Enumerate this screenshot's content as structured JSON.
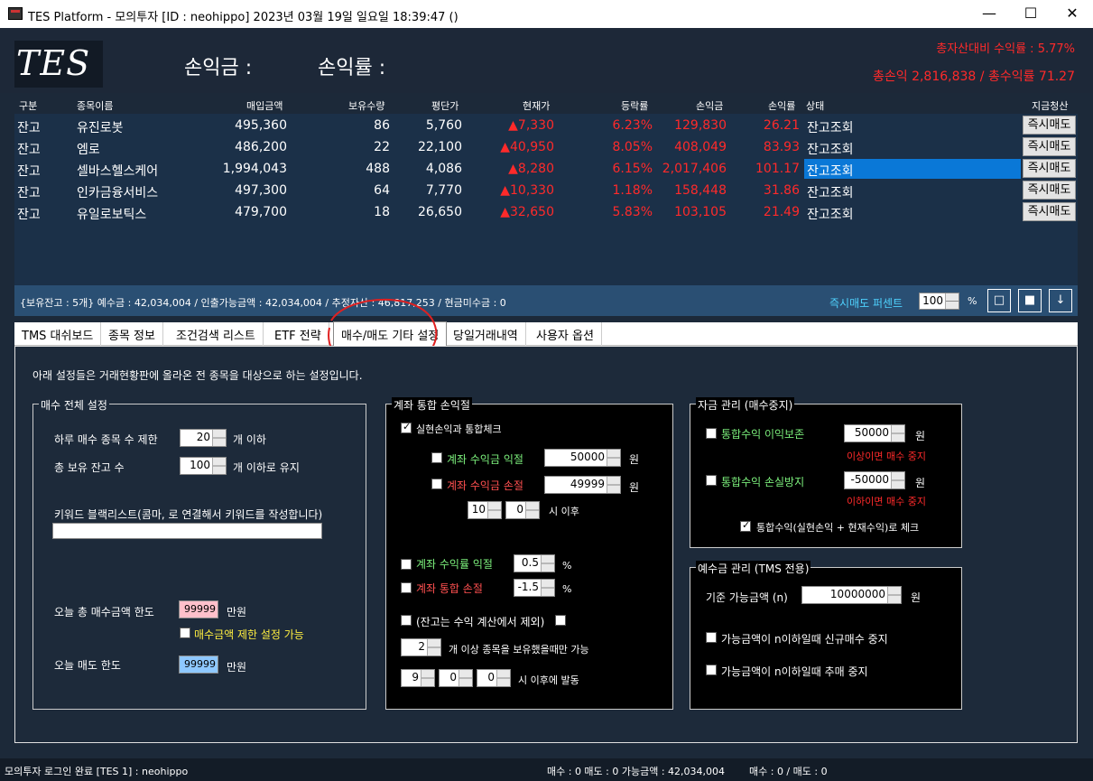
{
  "window": {
    "title": "TES Platform - 모의투자 [ID : neohippo] 2023년 03월 19일 일요일 18:39:47 ()",
    "minimize": "—",
    "maximize": "☐",
    "close": "✕"
  },
  "header": {
    "logo": "TES",
    "pnl_label": "손익금 :",
    "rate_label": "손익률 :",
    "asset_rate": "총자산대비 수익률 : 5.77%",
    "total": "총손익 2,816,838 / 총수익률 71.27"
  },
  "grid": {
    "columns": [
      "구분",
      "종목이름",
      "매입금액",
      "보유수량",
      "평단가",
      "현재가",
      "등락률",
      "손익금",
      "손익률",
      "상태",
      "지금청산"
    ],
    "rows": [
      {
        "type": "잔고",
        "name": "유진로봇",
        "buy": "495,360",
        "qty": "86",
        "avg": "5,760",
        "cur": "▲7,330",
        "chg": "6.23%",
        "pnl": "129,830",
        "rate": "26.21",
        "status": "잔고조회",
        "action": "즉시매도"
      },
      {
        "type": "잔고",
        "name": "엠로",
        "buy": "486,200",
        "qty": "22",
        "avg": "22,100",
        "cur": "▲40,950",
        "chg": "8.05%",
        "pnl": "408,049",
        "rate": "83.93",
        "status": "잔고조회",
        "action": "즉시매도"
      },
      {
        "type": "잔고",
        "name": "셀바스헬스케어",
        "buy": "1,994,043",
        "qty": "488",
        "avg": "4,086",
        "cur": "▲8,280",
        "chg": "6.15%",
        "pnl": "2,017,406",
        "rate": "101.17",
        "status": "잔고조회",
        "action": "즉시매도"
      },
      {
        "type": "잔고",
        "name": "인카금융서비스",
        "buy": "497,300",
        "qty": "64",
        "avg": "7,770",
        "cur": "▲10,330",
        "chg": "1.18%",
        "pnl": "158,448",
        "rate": "31.86",
        "status": "잔고조회",
        "action": "즉시매도"
      },
      {
        "type": "잔고",
        "name": "유일로보틱스",
        "buy": "479,700",
        "qty": "18",
        "avg": "26,650",
        "cur": "▲32,650",
        "chg": "5.83%",
        "pnl": "103,105",
        "rate": "21.49",
        "status": "잔고조회",
        "action": "즉시매도"
      }
    ]
  },
  "strip": {
    "info": "{보유잔고 : 5개}     예수금 : 42,034,004 / 인출가능금액 : 42,034,004 / 추정자산 : 46,817,253 / 현금미수금 : 0",
    "sell_pct_label": "즉시매도 퍼센트",
    "sell_pct": "100",
    "pct_unit": "%",
    "btn1": "□",
    "btn2": "■",
    "btn3": "↓"
  },
  "tabs": [
    "TMS 대쉬보드",
    "종목 정보",
    "조건검색 리스트",
    "ETF 전략",
    "매수/매도 기타 설정",
    "당일거래내역",
    "사용자 옵션"
  ],
  "intro": "아래 설정들은 거래현황판에 올라온 전 종목을 대상으로 하는 설정입니다.",
  "buy": {
    "title": "매수 전체 설정",
    "daily_limit_label": "하루 매수 종목 수 제한",
    "daily_limit": "20",
    "daily_limit_unit": "개 이하",
    "hold_label": "총 보유 잔고 수",
    "hold": "100",
    "hold_unit": "개 이하로 유지",
    "blacklist_label": "키워드 블랙리스트(콤마, 로 연결해서 키워드를 작성합니다)",
    "blacklist": "",
    "buy_amt_label": "오늘 총 매수금액 한도",
    "buy_amt": "99999",
    "won": "만원",
    "limit_chk": "매수금액 제한 설정 가능",
    "sell_amt_label": "오늘 매도 한도",
    "sell_amt": "99999"
  },
  "account": {
    "title": "계좌 통합 손익절",
    "realized_chk": "실현손익과 통합체크",
    "tp_label": "계좌 수익금 익절",
    "tp": "50000",
    "sl_label": "계좌 수익금 손절",
    "sl": "49999",
    "won": "원",
    "h": "10",
    "m": "0",
    "after": "시 이후",
    "rtp_label": "계좌 수익률 익절",
    "rtp": "0.5",
    "rsl_label": "계좌 통합 손절",
    "rsl": "-1.5",
    "pct": "%",
    "excl_label": "(잔고는 수익 계산에서 제외)",
    "cnt": "2",
    "cnt_label": "개 이상 종목을 보유했을때만 가능",
    "t1": "9",
    "t2": "0",
    "t3": "0",
    "trigger": "시 이후에 발동"
  },
  "fund": {
    "title": "자금 관리 (매수중지)",
    "keep_label": "통합수익 이익보존",
    "keep": "50000",
    "keep_note": "이상이면 매수 중지",
    "loss_label": "통합수익 손실방지",
    "loss": "-50000",
    "loss_note": "이하이면 매수 중지",
    "combo": "통합수익(실현손익 + 현재수익)로 체크",
    "won": "원"
  },
  "deposit": {
    "title": "예수금 관리 (TMS 전용)",
    "base_label": "기준 가능금액 (n)",
    "base": "10000000",
    "won": "원",
    "new_stop": "가능금액이 n이하일때 신규매수 중지",
    "add_stop": "가능금액이 n이하일때 추매 중지"
  },
  "status": {
    "login": "모의투자 로그인 완료 [TES 1] : neohippo",
    "counts": "매수 : 0 매도 : 0 가능금액 : 42,034,004",
    "ratio": "매수 : 0 / 매도 : 0"
  },
  "colors": {
    "accent_red": "#ff2a2a",
    "selected": "#0a78d7",
    "annotation": "#e02020"
  }
}
